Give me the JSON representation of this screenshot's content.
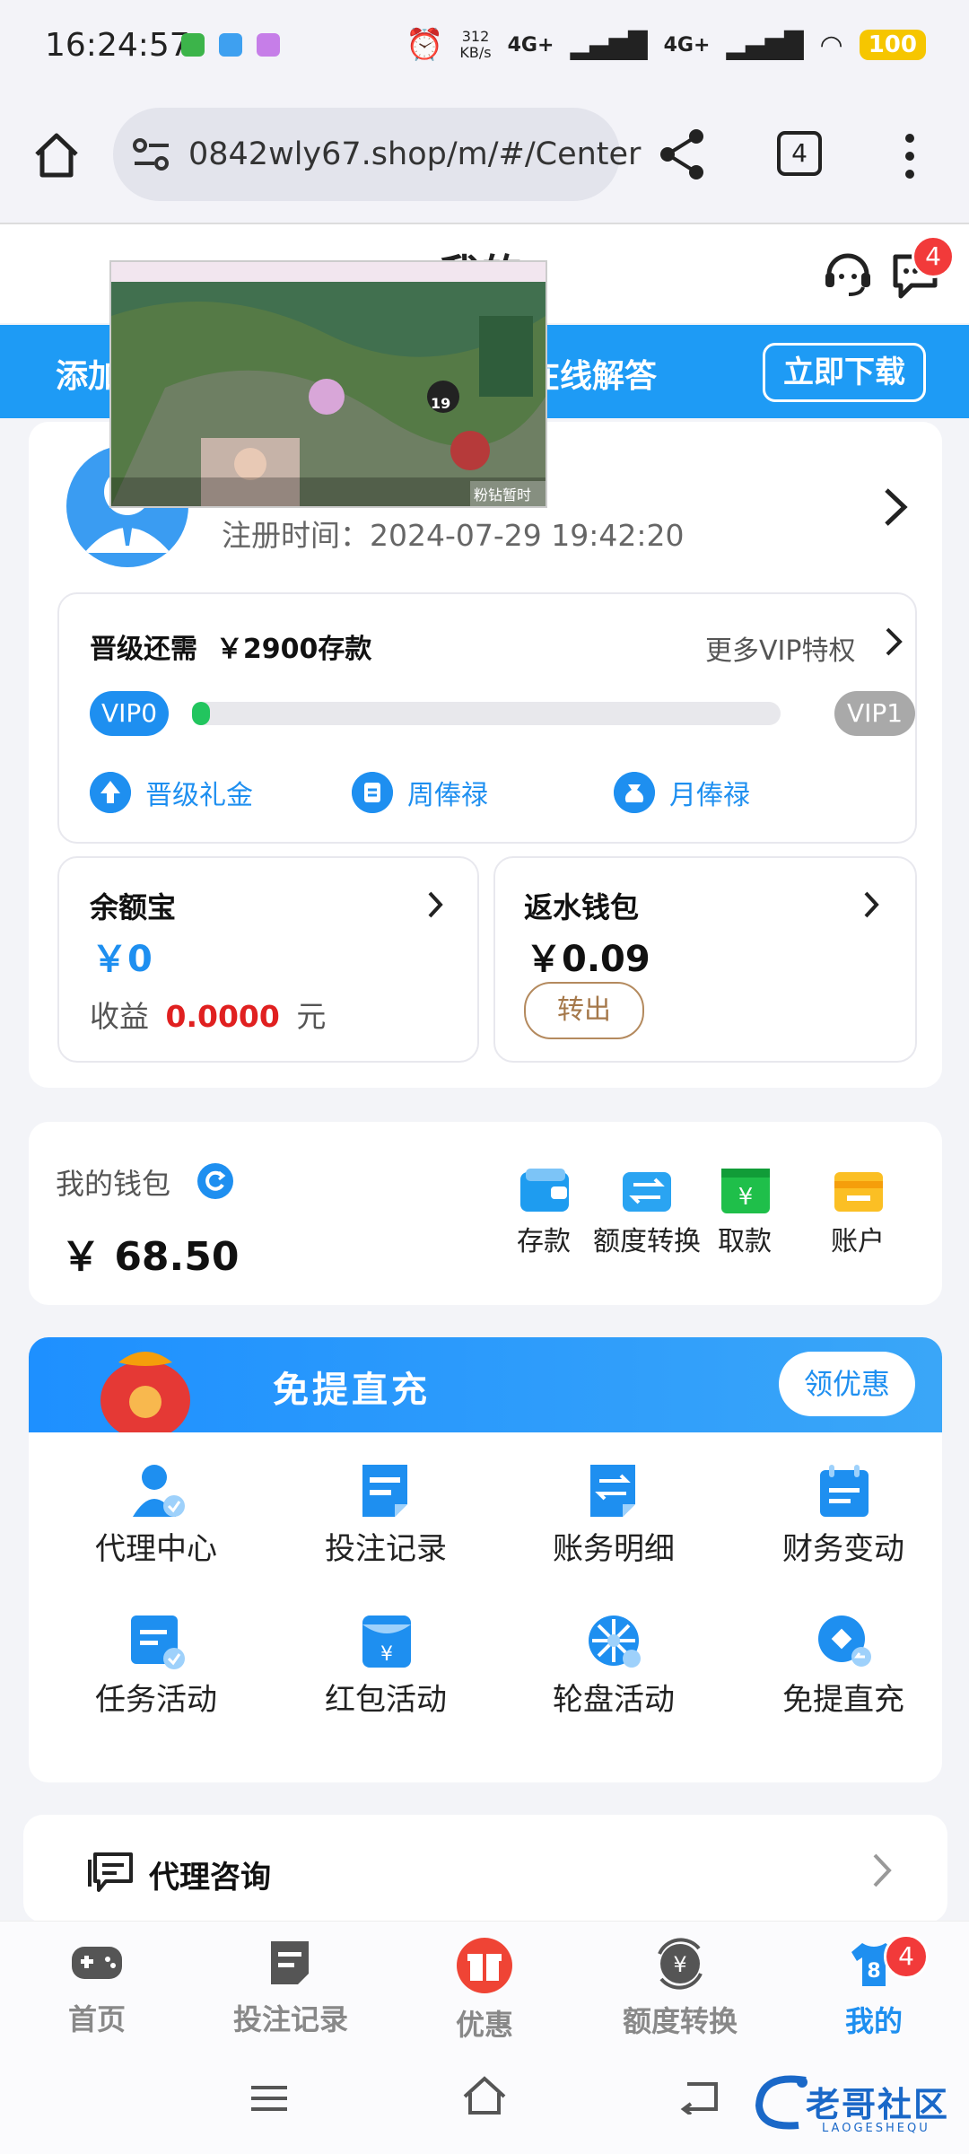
{
  "status": {
    "time": "16:24:57",
    "speed": "312\nKB/s",
    "net1": "4G+",
    "net2": "4G+",
    "battery": "100"
  },
  "browser": {
    "url": "0842wly67.shop/m/#/Center",
    "tabs": "4"
  },
  "header": {
    "title": "我的",
    "msg_badge": "4"
  },
  "banner": {
    "left": "添加",
    "middle": "在线解答",
    "download": "立即下载"
  },
  "profile": {
    "registered_label": "注册时间：",
    "registered_value": "2024-07-29 19:42:20"
  },
  "vip": {
    "upgrade_prefix": "晋级还需",
    "upgrade_amount": "￥2900存款",
    "more": "更多VIP特权",
    "current": "VIP0",
    "next": "VIP1",
    "progress": 0.02,
    "rewards": [
      "晋级礼金",
      "周俸禄",
      "月俸禄"
    ]
  },
  "yuebao": {
    "title": "余额宝",
    "value": "￥0",
    "income_label": "收益",
    "income_value": "0.0000",
    "income_unit": "元"
  },
  "rebate": {
    "title": "返水钱包",
    "value": "￥0.09",
    "button": "转出"
  },
  "wallet": {
    "title": "我的钱包",
    "balance": "￥ 68.50",
    "actions": [
      "存款",
      "额度转换",
      "取款",
      "账户"
    ]
  },
  "promo": {
    "title": "免提直充",
    "button": "领优惠",
    "grid": [
      "代理中心",
      "投注记录",
      "账务明细",
      "财务变动",
      "任务活动",
      "红包活动",
      "轮盘活动",
      "免提直充"
    ]
  },
  "agent": {
    "title": "代理咨询"
  },
  "nav": {
    "items": [
      "首页",
      "投注记录",
      "优惠",
      "额度转换",
      "我的"
    ],
    "badge": "4",
    "active_color": "#1e8ff0"
  },
  "video": {
    "caption": "粉钻暂时满啦",
    "level": "19"
  },
  "watermark": {
    "text": "老哥社区",
    "sub": "LAOGESHEQU"
  }
}
